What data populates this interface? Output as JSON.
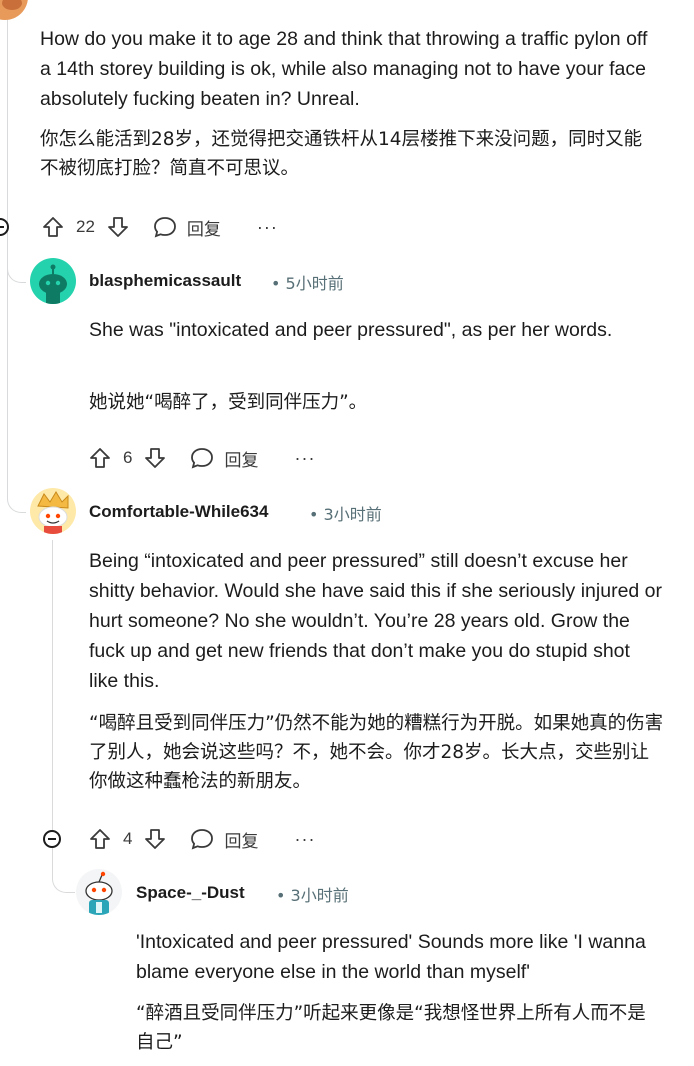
{
  "comments": [
    {
      "text_en": "How do you make it to age 28 and think that throwing a traffic pylon off a 14th storey building is ok, while also managing not to have your face absolutely fucking beaten in? Unreal.",
      "text_zh": "你怎么能活到28岁，还觉得把交通铁杆从14层楼推下来没问题，同时又能不被彻底打脸？简直不可思议。",
      "votes": "22",
      "reply_label": "回复",
      "more_label": "···"
    },
    {
      "username": "blasphemicassault",
      "time": "• 5小时前",
      "text_en": "She was \"intoxicated and peer pressured\", as per her words.",
      "text_zh": "她说她“喝醉了，受到同伴压力”。",
      "votes": "6",
      "reply_label": "回复",
      "more_label": "···",
      "avatar_color": "#24d3ad"
    },
    {
      "username": "Comfortable-While634",
      "time": "• 3小时前",
      "text_en": "Being “intoxicated and peer pressured” still doesn’t excuse her shitty behavior. Would she have said this if she seriously injured or hurt someone? No she wouldn’t. You’re 28 years old. Grow the fuck up and get new friends that don’t make you do stupid shot like this.",
      "text_zh": "“喝醉且受到同伴压力”仍然不能为她的糟糕行为开脱。如果她真的伤害了别人，她会说这些吗？不，她不会。你才28岁。长大点，交些别让你做这种蠢枪法的新朋友。",
      "votes": "4",
      "reply_label": "回复",
      "more_label": "···"
    },
    {
      "username": "Space-_-Dust",
      "time": "• 3小时前",
      "text_en": "'Intoxicated and peer pressured' Sounds more like 'I wanna blame everyone else in the world than myself'",
      "text_zh": "“醉酒且受同伴压力”听起来更像是“我想怪世界上所有人而不是自己”"
    }
  ],
  "colors": {
    "text": "#1c1c1c",
    "meta": "#576f76",
    "thread_line": "#d8dadc"
  }
}
